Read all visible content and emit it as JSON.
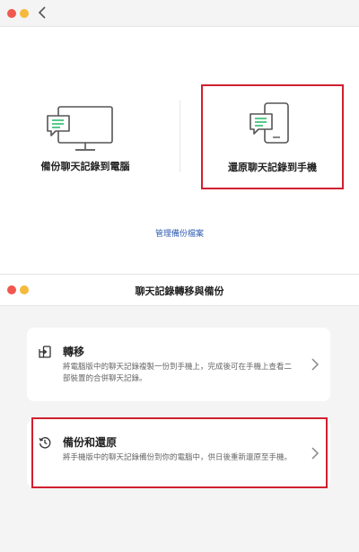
{
  "top_window": {
    "option_backup_to_computer": {
      "label": "備份聊天記錄到電腦",
      "icon": "monitor-chat-icon"
    },
    "option_restore_to_phone": {
      "label": "還原聊天記錄到手機",
      "icon": "phone-chat-icon"
    },
    "manage_backups_link": "管理備份檔案"
  },
  "bottom_window": {
    "title": "聊天記錄轉移與備份",
    "cards": [
      {
        "title": "轉移",
        "description": "將電腦版中的聊天記錄複製一份到手機上，完成後可在手機上查看二部裝置的合併聊天記錄。",
        "icon": "transfer-icon"
      },
      {
        "title": "備份和還原",
        "description": "將手機版中的聊天記錄備份到你的電腦中，供日後重新還原至手機。",
        "icon": "history-icon"
      }
    ]
  },
  "colors": {
    "highlight": "#d0202f",
    "link": "#2e5bb0",
    "close": "#f0584f",
    "minimize": "#f6b93b"
  }
}
